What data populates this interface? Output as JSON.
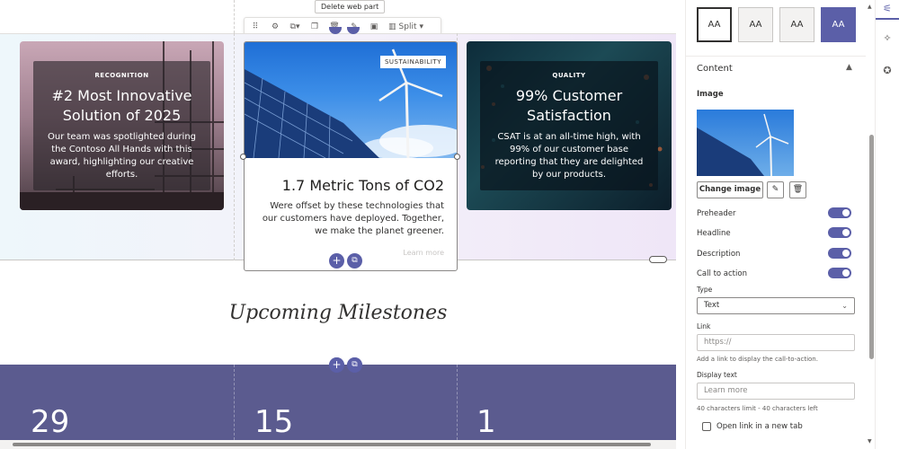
{
  "toolbar": {
    "tooltip": "Delete web part",
    "split_label": "Split"
  },
  "cards": [
    {
      "preheader": "RECOGNITION",
      "headline": "#2 Most Innovative Solution of 2025",
      "description": "Our team was spotlighted during the Contoso All Hands with this award, highlighting our creative efforts."
    },
    {
      "preheader": "SUSTAINABILITY",
      "headline": "1.7 Metric Tons of CO2",
      "description": "Were offset by these technologies that our customers have deployed. Together, we make the planet greener.",
      "cta": "Learn more"
    },
    {
      "preheader": "QUALITY",
      "headline": "99% Customer Satisfaction",
      "description": "CSAT is at an all-time high, with 99% of our customer base reporting that they are delighted by our products."
    }
  ],
  "milestones": {
    "title": "Upcoming Milestones",
    "stats": [
      "29",
      "15",
      "1"
    ]
  },
  "panel": {
    "style_options": [
      "AA",
      "AA",
      "AA",
      "AA"
    ],
    "section_title": "Content",
    "image_label": "Image",
    "change_image": "Change image",
    "toggles": [
      {
        "label": "Preheader"
      },
      {
        "label": "Headline"
      },
      {
        "label": "Description"
      },
      {
        "label": "Call to action"
      }
    ],
    "type_label": "Type",
    "type_value": "Text",
    "link_label": "Link",
    "link_placeholder": "https://",
    "link_help": "Add a link to display the call-to-action.",
    "display_text_label": "Display text",
    "display_text_placeholder": "Learn more",
    "display_text_help": "40 characters limit - 40 characters left",
    "new_tab_label": "Open link in a new tab"
  },
  "colors": {
    "accent": "#5b5fa8",
    "stats_band": "#5b5b8f"
  }
}
